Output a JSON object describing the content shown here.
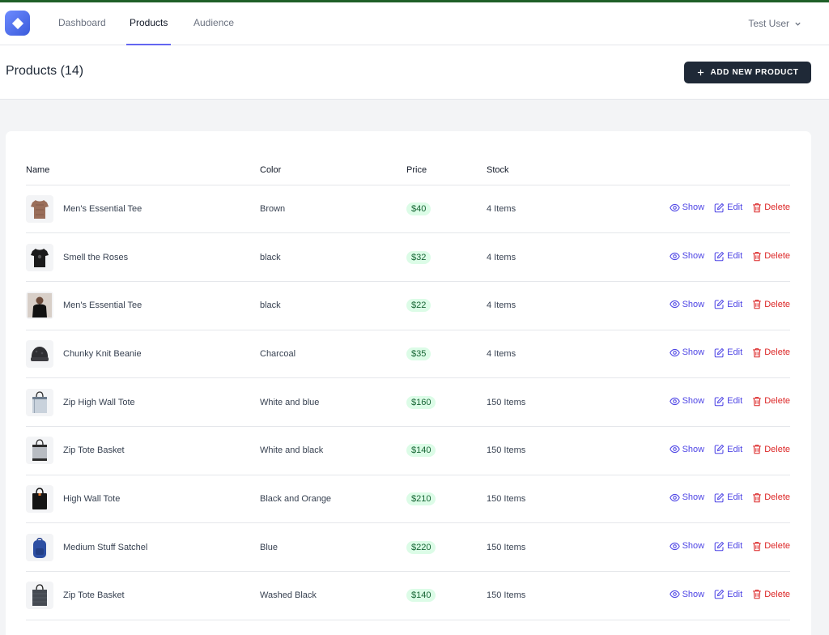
{
  "nav": {
    "links": [
      {
        "label": "Dashboard"
      },
      {
        "label": "Products"
      },
      {
        "label": "Audience"
      }
    ],
    "user_label": "Test User",
    "active_color": "#6366f1"
  },
  "header": {
    "title": "Products (14)",
    "add_button_label": "ADD NEW PRODUCT"
  },
  "table": {
    "headers": {
      "name": "Name",
      "color": "Color",
      "price": "Price",
      "stock": "Stock"
    },
    "actions": {
      "show": "Show",
      "edit": "Edit",
      "delete": "Delete"
    },
    "rows": [
      {
        "name": "Men's Essential Tee",
        "color": "Brown",
        "price": "$40",
        "stock": "4 Items",
        "thumb": "tshirt-brown"
      },
      {
        "name": "Smell the Roses",
        "color": "black",
        "price": "$32",
        "stock": "4 Items",
        "thumb": "tshirt-black"
      },
      {
        "name": "Men's Essential Tee",
        "color": "black",
        "price": "$22",
        "stock": "4 Items",
        "thumb": "person-tee"
      },
      {
        "name": "Chunky Knit Beanie",
        "color": "Charcoal",
        "price": "$35",
        "stock": "4 Items",
        "thumb": "beanie"
      },
      {
        "name": "Zip High Wall Tote",
        "color": "White and blue",
        "price": "$160",
        "stock": "150 Items",
        "thumb": "tote-light"
      },
      {
        "name": "Zip Tote Basket",
        "color": "White and black",
        "price": "$140",
        "stock": "150 Items",
        "thumb": "tote-gray"
      },
      {
        "name": "High Wall Tote",
        "color": "Black and Orange",
        "price": "$210",
        "stock": "150 Items",
        "thumb": "tote-black"
      },
      {
        "name": "Medium Stuff Satchel",
        "color": "Blue",
        "price": "$220",
        "stock": "150 Items",
        "thumb": "backpack-blue"
      },
      {
        "name": "Zip Tote Basket",
        "color": "Washed Black",
        "price": "$140",
        "stock": "150 Items",
        "thumb": "tote-dark"
      }
    ]
  },
  "colors": {
    "primary_dark": "#1f2937",
    "accent": "#4f46e5",
    "danger": "#dc2626",
    "price_bg": "#dcfce7",
    "price_text": "#166534"
  }
}
